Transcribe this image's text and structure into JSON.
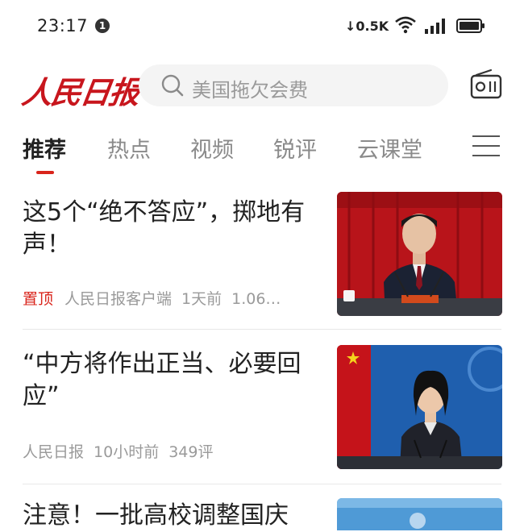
{
  "status_bar": {
    "time": "23:17",
    "notification_count": "1",
    "net_speed": "0.5K"
  },
  "header": {
    "logo_text": "人民日报",
    "search_placeholder": "美国拖欠会费"
  },
  "tabs": [
    {
      "label": "推荐",
      "active": true
    },
    {
      "label": "热点"
    },
    {
      "label": "视频"
    },
    {
      "label": "锐评"
    },
    {
      "label": "云课堂"
    }
  ],
  "feed": [
    {
      "title": "这5个“绝不答应”，掷地有声！",
      "pinned_label": "置顶",
      "source": "人民日报客户端",
      "time": "1天前",
      "extra": "1.06…"
    },
    {
      "title": "“中方将作出正当、必要回应”",
      "source": "人民日报",
      "time": "10小时前",
      "comments": "349评"
    },
    {
      "title": "注意！一批高校调整国庆"
    }
  ],
  "colors": {
    "brand_red": "#c8161d",
    "active_indicator": "#d9241b"
  }
}
